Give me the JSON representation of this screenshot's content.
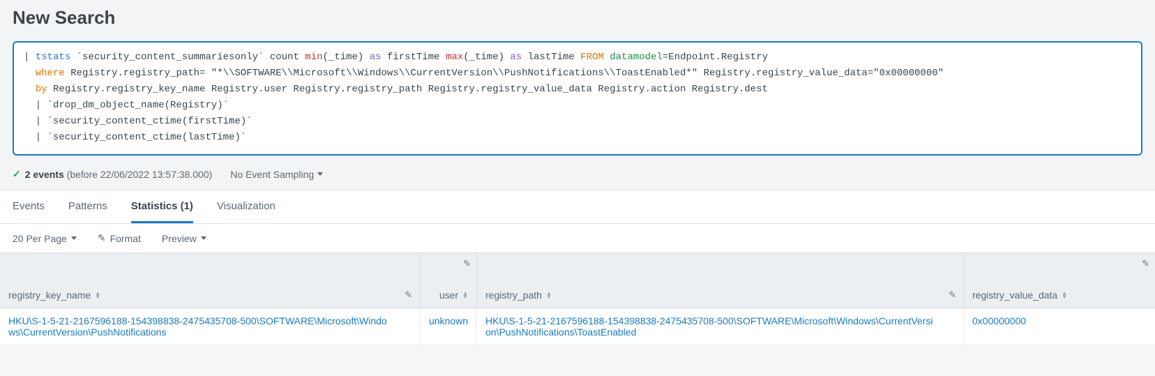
{
  "title": "New Search",
  "search": {
    "tokens": {
      "pipe": "| ",
      "tstats": "tstats",
      "macro1": " `security_content_summariesonly` count ",
      "min": "min",
      "min_arg": "(_time) ",
      "as1": "as",
      "firstTime": " firstTime ",
      "max": "max",
      "max_arg": "(_time) ",
      "as2": "as",
      "lastTime": " lastTime ",
      "from": "FROM ",
      "dm": "datamodel",
      "dmEq": "=Endpoint.Registry ",
      "where": "where",
      "where_rest": " Registry.registry_path= \"*\\\\SOFTWARE\\\\Microsoft\\\\Windows\\\\CurrentVersion\\\\PushNotifications\\\\ToastEnabled*\" Registry.registry_value_data=\"0x00000000\" ",
      "by": "by",
      "by_rest": " Registry.registry_key_name Registry.user Registry.registry_path Registry.registry_value_data Registry.action Registry.dest ",
      "line4": "  | `drop_dm_object_name(Registry)` ",
      "line5": "  | `security_content_ctime(firstTime)` ",
      "line6": "  | `security_content_ctime(lastTime)`"
    }
  },
  "status": {
    "events_bold": "2 events",
    "events_suffix": " (before 22/06/2022 13:57:38.000)",
    "sampling_label": "No Event Sampling"
  },
  "tabs": {
    "events": "Events",
    "patterns": "Patterns",
    "statistics": "Statistics (1)",
    "visualization": "Visualization"
  },
  "toolbar": {
    "per_page": "20 Per Page",
    "format": "Format",
    "preview": "Preview"
  },
  "columns": {
    "registry_key_name": "registry_key_name",
    "user": "user",
    "registry_path": "registry_path",
    "registry_value_data": "registry_value_data"
  },
  "rows": [
    {
      "registry_key_name": "HKU\\S-1-5-21-2167596188-154398838-2475435708-500\\SOFTWARE\\Microsoft\\Windows\\CurrentVersion\\PushNotifications",
      "user": "unknown",
      "registry_path": "HKU\\S-1-5-21-2167596188-154398838-2475435708-500\\SOFTWARE\\Microsoft\\Windows\\CurrentVersion\\PushNotifications\\ToastEnabled",
      "registry_value_data": "0x00000000"
    }
  ]
}
